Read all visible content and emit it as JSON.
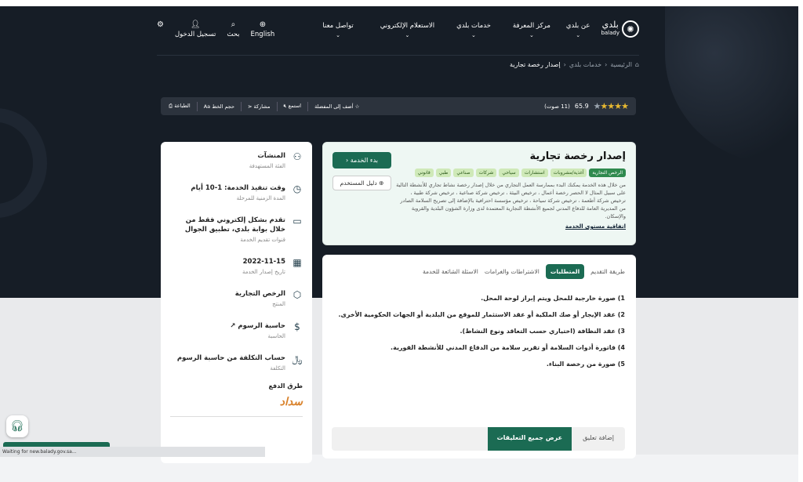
{
  "header": {
    "logo_text": "بلدي",
    "logo_sub": "balady",
    "nav": [
      "عن بلدي",
      "مركز المعرفة",
      "خدمات بلدي",
      "الاستعلام الإلكتروني",
      "تواصل معنا"
    ],
    "language": "English",
    "search": "بحث",
    "login": "تسجيل الدخول"
  },
  "breadcrumb": {
    "home": "الرئيسية",
    "section": "خدمات بلدي",
    "current": "إصدار رخصة تجارية"
  },
  "toolbar": {
    "stars": "★★★★",
    "empty_star": "★",
    "rating": "65.9",
    "votes": "(11 صوت)",
    "favorite": "أضف إلى المفضلة",
    "listen": "استمع",
    "share": "مشاركة",
    "font_size": "حجم الخط",
    "print": "الطباعة"
  },
  "service": {
    "title": "إصدار رخصة تجارية",
    "start": "بدء الخدمة",
    "guide": "دليل المستخدم",
    "tags": [
      "الرخص التجارية",
      "أغذية/مشروبات",
      "استشارات",
      "سياحي",
      "شركات",
      "صناعي",
      "طبي",
      "قانوني"
    ],
    "description": "من خلال هذه الخدمة يمكنك البدء بممارسة العمل التجاري من خلال إصدار رخصة نشاط تجاري للأنشطة التالية على سبيل المثال لا الحصر رخصة أعمال ، ترخيص البيئة ، ترخيص شركة صناعية ، ترخيص شركة طبية ، ترخيص شركة أطعمة ، ترخيص شركة سياحة ، ترخيص مؤسسة احترافية بالإضافة إلى تصريح السلامة الصادر من المديرية العامة للدفاع المدني لجميع الأنشطة التجارية المعتمدة لدى وزارة الشؤون البلدية والقروية والإسكان.",
    "agreement": "اتفاقية مستوى الخدمة"
  },
  "info": [
    {
      "icon": "person-icon",
      "value": "المنشآت",
      "label": "الفئة المستهدفة"
    },
    {
      "icon": "clock-icon",
      "value": "وقت تنفيذ الخدمة: 1-10 أيام",
      "label": "المدة الزمنية للمرحلة"
    },
    {
      "icon": "monitor-icon",
      "value": "تقدم بشكل إلكتروني فقط من خلال بوابة بلدي، تطبيق الجوال",
      "label": "قنوات تقديم الخدمة"
    },
    {
      "icon": "calendar-icon",
      "value": "2022-11-15",
      "label": "تاريخ إصدار الخدمة"
    },
    {
      "icon": "box-icon",
      "value": "الرخص التجارية",
      "label": "المنتج"
    },
    {
      "icon": "dollar-icon",
      "value": "حاسبة الرسوم ↗",
      "label": "الحاسبة"
    },
    {
      "icon": "riyal-icon",
      "value": "حساب التكلفة من حاسبة الرسوم",
      "label": "التكلفة"
    }
  ],
  "payment": {
    "title": "طرق الدفع",
    "logo": "سداد"
  },
  "tabs": [
    "طريقة التقديم",
    "المتطلبات",
    "الاشتراطات والغرامات",
    "الاسئلة الشائعة للخدمة"
  ],
  "requirements": [
    "1) صورة خارجية للمحل ويتم إبراز لوحة المحل.",
    "2) عقد الإيجار أو صك الملكية أو عقد الاستثمار للموقع من البلدية أو الجهات الحكومية الأخرى.",
    "3) عقد النظافة (اختياري حسب التعاقد ونوع النشاط).",
    "4) فاتورة أدوات السلامة أو تقرير سلامة من الدفاع المدني للأنشطة الفورية.",
    "5) صورة من رخصة البناء."
  ],
  "comments": {
    "add": "إضافة تعليق",
    "view_all": "عرض جميع التعليقات"
  },
  "status": "Waiting for new.balady.gov.sa..."
}
